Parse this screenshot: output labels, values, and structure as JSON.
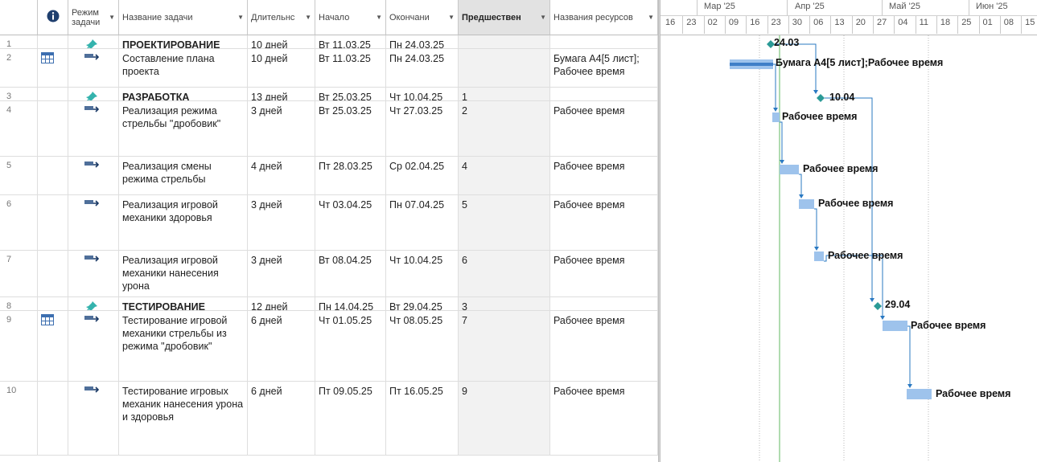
{
  "columns": {
    "info": "ⓘ",
    "mode": "Режим задачи",
    "name": "Название задачи",
    "duration": "Длительнс",
    "start": "Начало",
    "finish": "Окончани",
    "pred": "Предшествен",
    "resources": "Названия ресурсов"
  },
  "tasks": [
    {
      "id": "1",
      "name": "ПРОЕКТИРОВАНИЕ",
      "duration": "10 дней",
      "start": "Вт 11.03.25",
      "finish": "Пн 24.03.25",
      "pred": "",
      "resources": "",
      "summary": true,
      "grid_icon": false
    },
    {
      "id": "2",
      "name": "Составление плана проекта",
      "duration": "10 дней",
      "start": "Вт 11.03.25",
      "finish": "Пн 24.03.25",
      "pred": "",
      "resources": "Бумага А4[5 лист]; Рабочее время",
      "summary": false,
      "grid_icon": true
    },
    {
      "id": "3",
      "name": "РАЗРАБОТКА",
      "duration": "13 дней",
      "start": "Вт 25.03.25",
      "finish": "Чт 10.04.25",
      "pred": "1",
      "resources": "",
      "summary": true,
      "grid_icon": false
    },
    {
      "id": "4",
      "name": "Реализация режима стрельбы \"дробовик\"",
      "duration": "3 дней",
      "start": "Вт 25.03.25",
      "finish": "Чт 27.03.25",
      "pred": "2",
      "resources": "Рабочее время",
      "summary": false,
      "grid_icon": false
    },
    {
      "id": "5",
      "name": "Реализация смены режима стрельбы",
      "duration": "4 дней",
      "start": "Пт 28.03.25",
      "finish": "Ср 02.04.25",
      "pred": "4",
      "resources": "Рабочее время",
      "summary": false,
      "grid_icon": false
    },
    {
      "id": "6",
      "name": "Реализация игровой механики здоровья",
      "duration": "3 дней",
      "start": "Чт 03.04.25",
      "finish": "Пн 07.04.25",
      "pred": "5",
      "resources": "Рабочее время",
      "summary": false,
      "grid_icon": false
    },
    {
      "id": "7",
      "name": "Реализация игровой механики нанесения урона",
      "duration": "3 дней",
      "start": "Вт 08.04.25",
      "finish": "Чт 10.04.25",
      "pred": "6",
      "resources": "Рабочее время",
      "summary": false,
      "grid_icon": false
    },
    {
      "id": "8",
      "name": "ТЕСТИРОВАНИЕ",
      "duration": "12 дней",
      "start": "Пн 14.04.25",
      "finish": "Вт 29.04.25",
      "pred": "3",
      "resources": "",
      "summary": true,
      "grid_icon": false
    },
    {
      "id": "9",
      "name": "Тестирование игровой механики стрельбы из режима \"дробовик\"",
      "duration": "6 дней",
      "start": "Чт 01.05.25",
      "finish": "Чт 08.05.25",
      "pred": "7",
      "resources": "Рабочее время",
      "summary": false,
      "grid_icon": true
    },
    {
      "id": "10",
      "name": "Тестирование игровых механик нанесения урона и здоровья",
      "duration": "6 дней",
      "start": "Пт 09.05.25",
      "finish": "Пт 16.05.25",
      "pred": "9",
      "resources": "Рабочее время",
      "summary": false,
      "grid_icon": false
    }
  ],
  "timeline": {
    "months": [
      "Мар '25",
      "Апр '25",
      "Май '25",
      "Июн '25"
    ],
    "weeks": [
      "16",
      "23",
      "02",
      "09",
      "16",
      "23",
      "30",
      "06",
      "13",
      "20",
      "27",
      "04",
      "11",
      "18",
      "25",
      "01",
      "08",
      "15"
    ]
  },
  "gantt_labels": {
    "m1": "24.03",
    "t2": "Бумага А4[5 лист];Рабочее время",
    "m3": "10.04",
    "t4": "Рабочее время",
    "t5": "Рабочее время",
    "t6": "Рабочее время",
    "t7": "Рабочее время",
    "m8": "29.04",
    "t9": "Рабочее время",
    "t10": "Рабочее время"
  },
  "colors": {
    "bar": "#9ec3ec",
    "milestone": "#2a9a96",
    "link": "#2a79c2",
    "pin": "#34b3ad",
    "auto_icon": "#4f6f9a"
  }
}
